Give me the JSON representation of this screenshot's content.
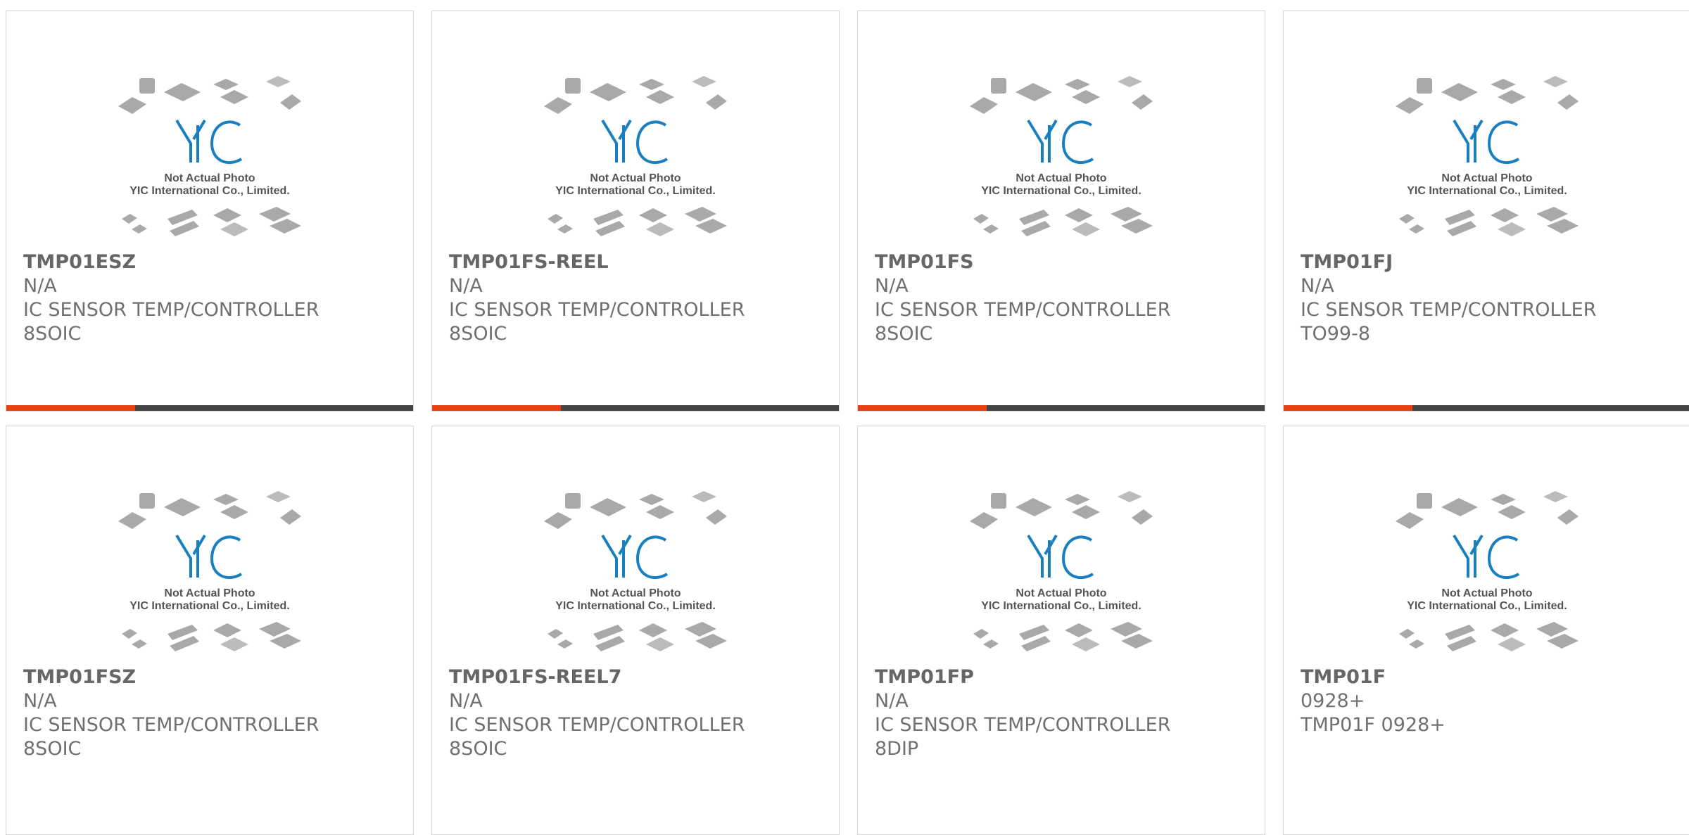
{
  "placeholder": {
    "brand": "YIC",
    "caption_line1": "Not Actual Photo",
    "caption_line2": "YIC International Co., Limited."
  },
  "colors": {
    "accent": "#e8400f",
    "bar": "#444444",
    "logo": "#1a7fc1"
  },
  "products": [
    {
      "part": "TMP01ESZ",
      "date_code": "N/A",
      "description": "IC SENSOR TEMP/CONTROLLER",
      "package": "8SOIC"
    },
    {
      "part": "TMP01FS-REEL",
      "date_code": "N/A",
      "description": "IC SENSOR TEMP/CONTROLLER",
      "package": "8SOIC"
    },
    {
      "part": "TMP01FS",
      "date_code": "N/A",
      "description": "IC SENSOR TEMP/CONTROLLER",
      "package": "8SOIC"
    },
    {
      "part": "TMP01FJ",
      "date_code": "N/A",
      "description": "IC SENSOR TEMP/CONTROLLER",
      "package": "TO99-8"
    },
    {
      "part": "TMP01FSZ",
      "date_code": "N/A",
      "description": "IC SENSOR TEMP/CONTROLLER",
      "package": "8SOIC"
    },
    {
      "part": "TMP01FS-REEL7",
      "date_code": "N/A",
      "description": "IC SENSOR TEMP/CONTROLLER",
      "package": "8SOIC"
    },
    {
      "part": "TMP01FP",
      "date_code": "N/A",
      "description": "IC SENSOR TEMP/CONTROLLER",
      "package": "8DIP"
    },
    {
      "part": "TMP01F",
      "date_code": "0928+",
      "description": "TMP01F 0928+",
      "package": ""
    }
  ]
}
